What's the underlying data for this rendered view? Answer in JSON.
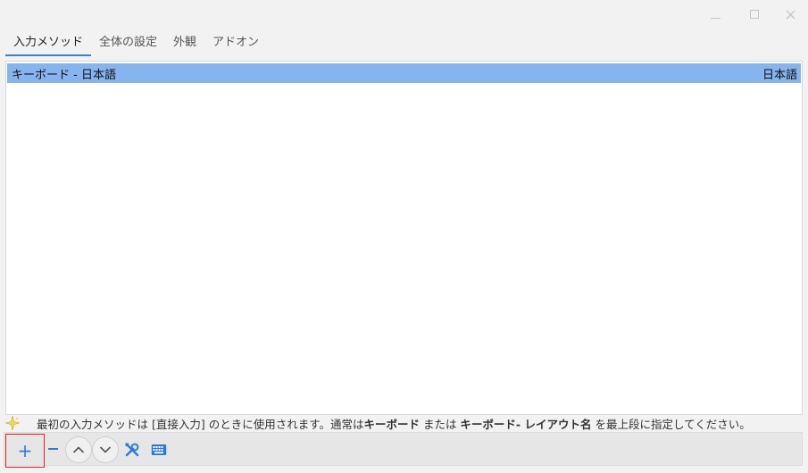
{
  "window": {
    "controls": {
      "minimize_icon": "minimize-icon",
      "maximize_icon": "maximize-icon",
      "close_icon": "close-icon"
    }
  },
  "tabs": [
    {
      "label": "入力メソッド",
      "active": true
    },
    {
      "label": "全体の設定",
      "active": false
    },
    {
      "label": "外観",
      "active": false
    },
    {
      "label": "アドオン",
      "active": false
    }
  ],
  "list": {
    "rows": [
      {
        "name": "キーボード - 日本語",
        "language": "日本語",
        "selected": true
      }
    ]
  },
  "hint": {
    "part1": "最初の入力メソッドは [直接入力] のときに使用されます。通常は ",
    "bold1": "キーボード",
    "part2": " または ",
    "bold2": "キーボード- レイアウト名",
    "part3": " を最上段に指定してください。"
  },
  "toolbar": {
    "add_label": "+",
    "icons": [
      "add-icon",
      "remove-icon",
      "move-up-icon",
      "move-down-icon",
      "configure-icon",
      "keyboard-layout-icon"
    ]
  },
  "colors": {
    "selection": "#86b4ef",
    "accent": "#2f7ad8",
    "highlight_border": "#e02020"
  }
}
